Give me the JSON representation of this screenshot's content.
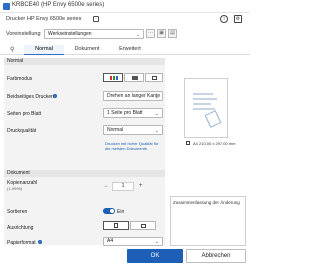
{
  "window": {
    "title": "KRBCE40 (HP Envy 6500e series)"
  },
  "printer": {
    "label": "Drucker",
    "name": "HP Envy 6500e series"
  },
  "preset": {
    "label": "Voreinstellung",
    "value": "Werkseinstellungen"
  },
  "tabs": [
    {
      "label": "Normal",
      "active": true
    },
    {
      "label": "Dokument",
      "active": false
    },
    {
      "label": "Erweitert",
      "active": false
    }
  ],
  "sections": {
    "normal": "Normal",
    "document": "Dokument"
  },
  "settings": {
    "color_mode": {
      "label": "Farbmodus"
    },
    "duplex": {
      "label": "Beidseitiges Drucken",
      "value": "Drehen an langer Kante"
    },
    "pages_per_sheet": {
      "label": "Seiten pro Blatt",
      "value": "1 Seite pro Blatt"
    },
    "quality": {
      "label": "Druckqualität",
      "value": "Normal"
    },
    "quality_note": "Drucken mit hoher Qualität für die meisten Dokumente."
  },
  "document": {
    "copies_label": "Kopienanzahl",
    "copies_range": "(1-9999)",
    "copies_value": "1",
    "collate_label": "Sortieren",
    "collate_state": "Ein",
    "orientation_label": "Ausrichtung",
    "paper_label": "Papierformat",
    "paper_value": "A4"
  },
  "preview": {
    "caption": "A4 210,00 x 297,00 mm",
    "summary_title": "Zusammenfassung der Änderung"
  },
  "buttons": {
    "ok": "OK",
    "cancel": "Abbrechen"
  },
  "colors": {
    "accent": "#1d5fb8",
    "panel": "#f3f3f3"
  }
}
